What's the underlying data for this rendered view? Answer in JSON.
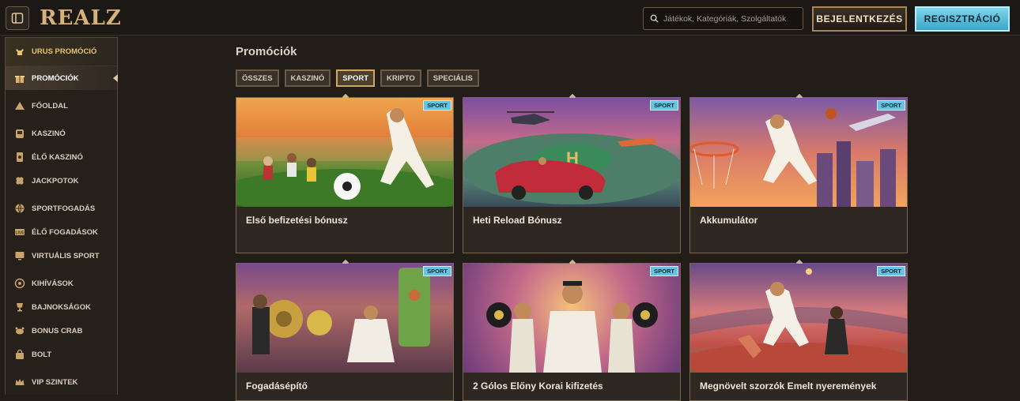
{
  "header": {
    "logo": "REALZ",
    "search_placeholder": "Játékok, Kategóriák, Szolgáltatók",
    "login_label": "BEJELENTKEZÉS",
    "register_label": "REGISZTRÁCIÓ"
  },
  "sidebar": {
    "items": [
      {
        "label": "URUS PROMÓCIÓ",
        "icon": "bull-icon"
      },
      {
        "label": "PROMÓCIÓK",
        "icon": "gift-icon"
      },
      {
        "label": "FŐOLDAL",
        "icon": "pyramid-icon"
      },
      {
        "label": "KASZINÓ",
        "icon": "casino-chip-icon"
      },
      {
        "label": "ÉLŐ KASZINÓ",
        "icon": "cards-icon"
      },
      {
        "label": "JACKPOTOK",
        "icon": "clover-icon"
      },
      {
        "label": "SPORTFOGADÁS",
        "icon": "ball-icon"
      },
      {
        "label": "ÉLŐ FOGADÁSOK",
        "icon": "live-icon"
      },
      {
        "label": "VIRTUÁLIS SPORT",
        "icon": "screen-icon"
      },
      {
        "label": "KIHÍVÁSOK",
        "icon": "target-icon"
      },
      {
        "label": "BAJNOKSÁGOK",
        "icon": "trophy-icon"
      },
      {
        "label": "BONUS CRAB",
        "icon": "crab-icon"
      },
      {
        "label": "BOLT",
        "icon": "bag-icon"
      },
      {
        "label": "VIP SZINTEK",
        "icon": "crown-icon"
      }
    ]
  },
  "main": {
    "title": "Promóciók",
    "tabs": [
      "ÖSSZES",
      "KASZINÓ",
      "SPORT",
      "KRIPTO",
      "SPECIÁLIS"
    ],
    "active_tab": "SPORT",
    "cards": [
      {
        "title": "Első befizetési bónusz",
        "badge": "SPORT"
      },
      {
        "title": "Heti Reload Bónusz",
        "badge": "SPORT"
      },
      {
        "title": "Akkumulátor",
        "badge": "SPORT"
      },
      {
        "title": "Fogadásépítő",
        "badge": "SPORT"
      },
      {
        "title": "2 Gólos Előny Korai kifizetés",
        "badge": "SPORT"
      },
      {
        "title": "Megnövelt szorzók Emelt nyeremények",
        "badge": "SPORT"
      }
    ]
  },
  "colors": {
    "accent_gold": "#cfa75e",
    "accent_blue": "#68c3e0",
    "background": "#221d19"
  }
}
